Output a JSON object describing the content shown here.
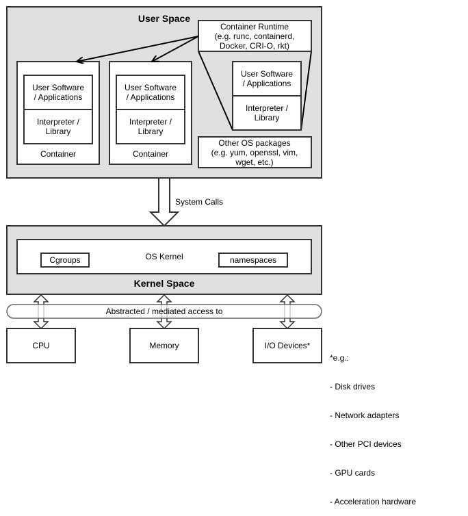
{
  "user_space": {
    "title": "User Space",
    "container_runtime": [
      "Container Runtime",
      "(e.g. runc, containerd,",
      "Docker, CRI-O, rkt)"
    ],
    "containers": [
      {
        "app": [
          "User Software",
          "/ Applications"
        ],
        "lib": [
          "Interpreter /",
          "Library"
        ],
        "label": "Container"
      },
      {
        "app": [
          "User Software",
          "/ Applications"
        ],
        "lib": [
          "Interpreter /",
          "Library"
        ],
        "label": "Container"
      }
    ],
    "runtime_detail": {
      "app": [
        "User Software",
        "/ Applications"
      ],
      "lib": [
        "Interpreter /",
        "Library"
      ]
    },
    "other_packages": [
      "Other OS packages",
      "(e.g. yum, openssl, vim,",
      "wget, etc.)"
    ]
  },
  "system_calls": "System Calls",
  "kernel_space": {
    "title": "Kernel Space",
    "os_kernel": "OS Kernel",
    "cgroups": "Cgroups",
    "namespaces": "namespaces"
  },
  "access_bar": "Abstracted / mediated access to",
  "hardware": [
    "CPU",
    "Memory",
    "I/O Devices*"
  ],
  "footnote": {
    "heading": "*e.g.:",
    "items": [
      "- Disk drives",
      "- Network adapters",
      "- Other PCI devices",
      "- GPU cards",
      "- Acceleration hardware"
    ]
  }
}
